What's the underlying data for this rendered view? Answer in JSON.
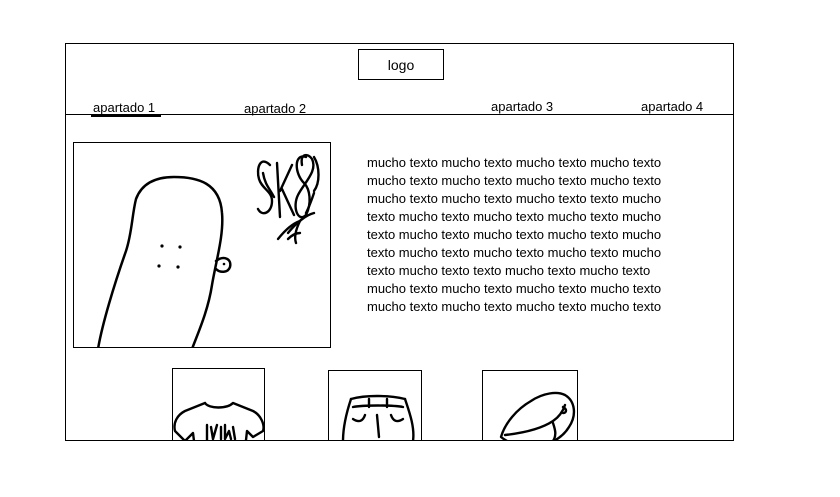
{
  "header": {
    "logo_label": "logo"
  },
  "nav": {
    "items": [
      {
        "label": "apartado 1"
      },
      {
        "label": "apartado 2"
      },
      {
        "label": "apartado 3"
      },
      {
        "label": "apartado 4"
      }
    ],
    "active": "apartado 1"
  },
  "main": {
    "hero_image_icon": "skateboard-sketch",
    "hero_image_scribble": "SK8",
    "body_text": "mucho texto  mucho texto  mucho texto  mucho texto  mucho texto  mucho texto  mucho texto mucho texto  mucho texto  mucho texto  mucho texto texto  mucho texto  mucho texto  mucho texto mucho texto  mucho texto  mucho texto  mucho texto  mucho texto  mucho texto  mucho texto mucho texto  mucho texto  mucho texto  mucho texto texto  mucho texto  mucho texto  mucho texto mucho texto  mucho texto  mucho texto  mucho texto  mucho texto  mucho texto  mucho texto"
  },
  "products": [
    {
      "icon": "tshirt-sketch"
    },
    {
      "icon": "pants-sketch"
    },
    {
      "icon": "cap-sketch"
    }
  ]
}
